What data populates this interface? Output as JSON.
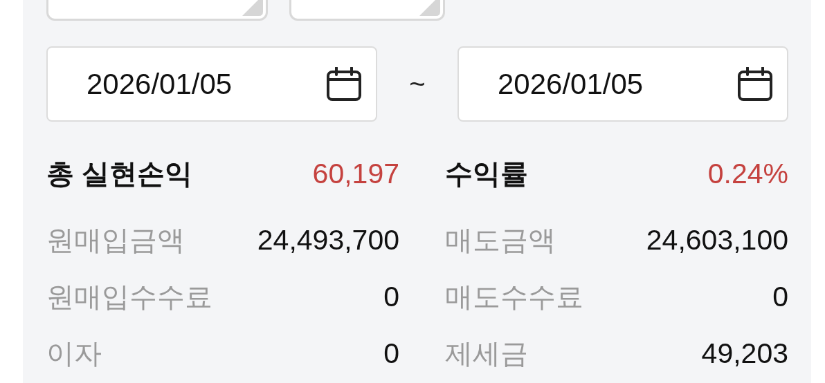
{
  "dropdowns": [
    {
      "kind": "dropdown"
    },
    {
      "kind": "dropdown"
    }
  ],
  "date_range": {
    "start": "2026/01/05",
    "separator": "~",
    "end": "2026/01/05"
  },
  "summary": {
    "left": [
      {
        "kind": "total",
        "label": "총 실현손익",
        "value": "60,197"
      },
      {
        "kind": "detail",
        "label": "원매입금액",
        "value": "24,493,700"
      },
      {
        "kind": "detail",
        "label": "원매입수수료",
        "value": "0"
      },
      {
        "kind": "detail",
        "label": "이자",
        "value": "0"
      }
    ],
    "right": [
      {
        "kind": "total",
        "label": "수익률",
        "value": "0.24%"
      },
      {
        "kind": "detail",
        "label": "매도금액",
        "value": "24,603,100"
      },
      {
        "kind": "detail",
        "label": "매도수수료",
        "value": "0"
      },
      {
        "kind": "detail",
        "label": "제세금",
        "value": "49,203"
      }
    ]
  }
}
